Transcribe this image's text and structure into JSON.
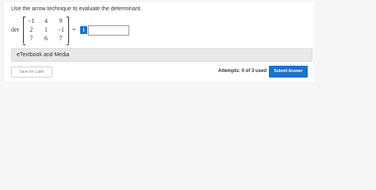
{
  "question": {
    "prompt": "Use the arrow technique to evaluate the determinant.",
    "det_label": "det",
    "matrix": [
      [
        "−1",
        "4",
        "9"
      ],
      [
        "2",
        "1",
        "−1"
      ],
      [
        "7",
        "6",
        "7"
      ]
    ],
    "equals": "=",
    "info_label": "i",
    "answer_value": ""
  },
  "etextbook_label": "eTextbook and Media",
  "footer": {
    "save_label": "Save for Later",
    "attempts_text": "Attempts: 0 of 3 used",
    "submit_label": "Submit Answer"
  },
  "colors": {
    "accent": "#1a73c9",
    "page_bg": "#f6f6f6",
    "card_bg": "#ffffff"
  }
}
